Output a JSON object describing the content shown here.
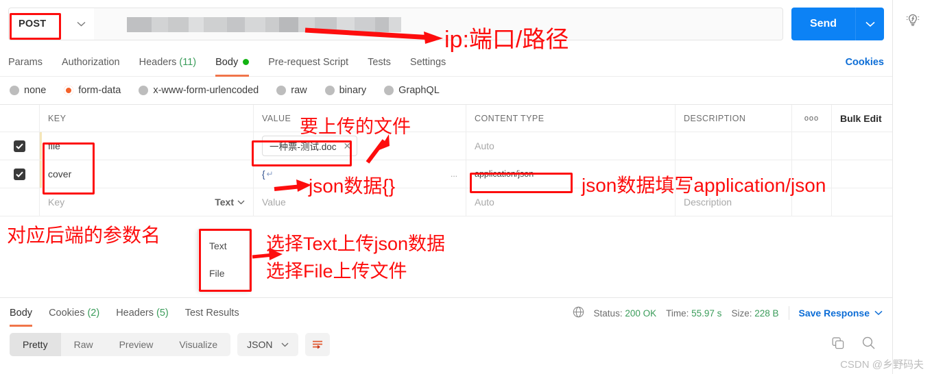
{
  "request": {
    "method": "POST",
    "url_placeholder": "",
    "send_label": "Send",
    "tabs": [
      {
        "label": "Params",
        "count": "",
        "dot": false
      },
      {
        "label": "Authorization",
        "count": "",
        "dot": false
      },
      {
        "label": "Headers",
        "count": "(11)",
        "dot": false
      },
      {
        "label": "Body",
        "count": "",
        "dot": true
      },
      {
        "label": "Pre-request Script",
        "count": "",
        "dot": false
      },
      {
        "label": "Tests",
        "count": "",
        "dot": false
      },
      {
        "label": "Settings",
        "count": "",
        "dot": false
      }
    ],
    "active_tab": "Body",
    "cookies_link": "Cookies"
  },
  "body_types": [
    {
      "label": "none",
      "selected": false
    },
    {
      "label": "form-data",
      "selected": true
    },
    {
      "label": "x-www-form-urlencoded",
      "selected": false
    },
    {
      "label": "raw",
      "selected": false
    },
    {
      "label": "binary",
      "selected": false
    },
    {
      "label": "GraphQL",
      "selected": false
    }
  ],
  "table": {
    "headers": {
      "key": "KEY",
      "value": "VALUE",
      "content_type": "CONTENT TYPE",
      "description": "DESCRIPTION",
      "more": "ooo",
      "bulk_edit": "Bulk Edit"
    },
    "rows": [
      {
        "checked": true,
        "key": "file",
        "value_file": "一种票-测试.doc",
        "value_close": "✕",
        "content_type": "Auto",
        "content_type_is_placeholder": true,
        "description": ""
      },
      {
        "checked": true,
        "key": "cover",
        "value_json": "{",
        "value_return_glyph": "↵",
        "value_overflow": "...",
        "content_type": "application/json",
        "content_type_is_placeholder": false,
        "description": ""
      }
    ],
    "empty_row": {
      "key_placeholder": "Key",
      "type_selector": "Text",
      "value_placeholder": "Value",
      "content_type_placeholder": "Auto",
      "description_placeholder": "Description"
    }
  },
  "type_dropdown": {
    "options": [
      "Text",
      "File"
    ]
  },
  "response": {
    "tabs": [
      {
        "label": "Body",
        "count": ""
      },
      {
        "label": "Cookies",
        "count": "(2)"
      },
      {
        "label": "Headers",
        "count": "(5)"
      },
      {
        "label": "Test Results",
        "count": ""
      }
    ],
    "active_tab": "Body",
    "status_label": "Status:",
    "status_value": "200 OK",
    "time_label": "Time:",
    "time_value": "55.97 s",
    "size_label": "Size:",
    "size_value": "228 B",
    "save_response": "Save Response",
    "format_tabs": [
      "Pretty",
      "Raw",
      "Preview",
      "Visualize"
    ],
    "active_format": "Pretty",
    "language": "JSON"
  },
  "annotations": [
    {
      "id": "url-note",
      "text": "ip:端口/路径"
    },
    {
      "id": "file-note",
      "text": "要上传的文件"
    },
    {
      "id": "json-note",
      "text": "json数据{}"
    },
    {
      "id": "ct-note",
      "text": "json数据填写application/json"
    },
    {
      "id": "key-note",
      "text": "对应后端的参数名"
    },
    {
      "id": "text-note",
      "text": "选择Text上传json数据"
    },
    {
      "id": "file-opt-note",
      "text": "选择File上传文件"
    }
  ],
  "watermark": "CSDN @乡野码夫",
  "colors": {
    "accent": "#f0754a",
    "primary": "#0c82f5",
    "link": "#0c6dd6",
    "success": "#3a9c5a",
    "annotation": "#fd0d0d"
  }
}
